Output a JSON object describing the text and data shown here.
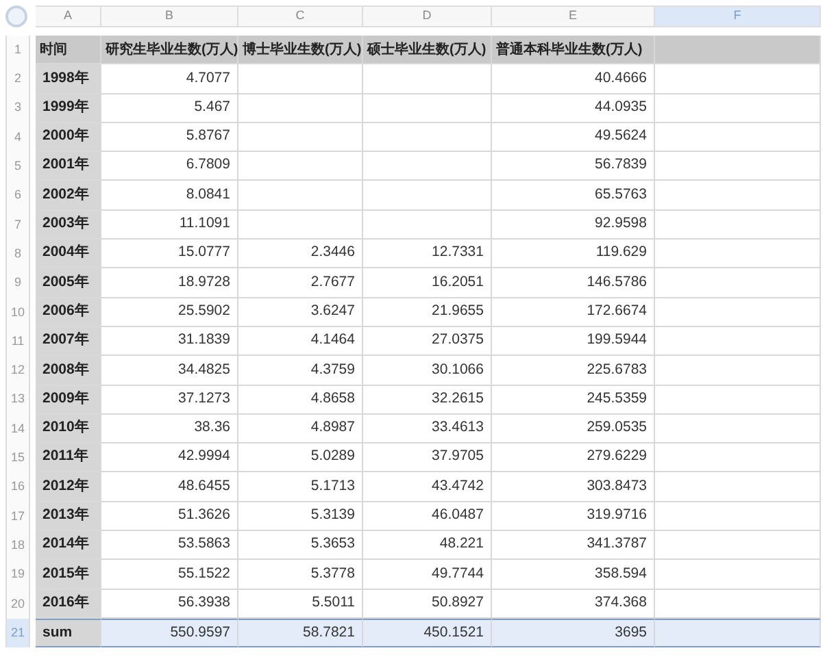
{
  "columns": [
    {
      "letter": "A",
      "selected": false
    },
    {
      "letter": "B",
      "selected": false
    },
    {
      "letter": "C",
      "selected": false
    },
    {
      "letter": "D",
      "selected": false
    },
    {
      "letter": "E",
      "selected": false
    },
    {
      "letter": "F",
      "selected": true
    }
  ],
  "rows": [
    {
      "number": "1",
      "kind": "header",
      "selected": false,
      "cells": [
        "时间",
        "研究生毕业生数(万人)",
        "博士毕业生数(万人)",
        "硕士毕业生数(万人)",
        "普通本科毕业生数(万人)"
      ]
    },
    {
      "number": "2",
      "kind": "data",
      "selected": false,
      "cells": [
        "1998年",
        "4.7077",
        null,
        null,
        "40.4666"
      ]
    },
    {
      "number": "3",
      "kind": "data",
      "selected": false,
      "cells": [
        "1999年",
        "5.467",
        null,
        null,
        "44.0935"
      ]
    },
    {
      "number": "4",
      "kind": "data",
      "selected": false,
      "cells": [
        "2000年",
        "5.8767",
        null,
        null,
        "49.5624"
      ]
    },
    {
      "number": "5",
      "kind": "data",
      "selected": false,
      "cells": [
        "2001年",
        "6.7809",
        null,
        null,
        "56.7839"
      ]
    },
    {
      "number": "6",
      "kind": "data",
      "selected": false,
      "cells": [
        "2002年",
        "8.0841",
        null,
        null,
        "65.5763"
      ]
    },
    {
      "number": "7",
      "kind": "data",
      "selected": false,
      "cells": [
        "2003年",
        "11.1091",
        null,
        null,
        "92.9598"
      ]
    },
    {
      "number": "8",
      "kind": "data",
      "selected": false,
      "cells": [
        "2004年",
        "15.0777",
        "2.3446",
        "12.7331",
        "119.629"
      ]
    },
    {
      "number": "9",
      "kind": "data",
      "selected": false,
      "cells": [
        "2005年",
        "18.9728",
        "2.7677",
        "16.2051",
        "146.5786"
      ]
    },
    {
      "number": "10",
      "kind": "data",
      "selected": false,
      "cells": [
        "2006年",
        "25.5902",
        "3.6247",
        "21.9655",
        "172.6674"
      ]
    },
    {
      "number": "11",
      "kind": "data",
      "selected": false,
      "cells": [
        "2007年",
        "31.1839",
        "4.1464",
        "27.0375",
        "199.5944"
      ]
    },
    {
      "number": "12",
      "kind": "data",
      "selected": false,
      "cells": [
        "2008年",
        "34.4825",
        "4.3759",
        "30.1066",
        "225.6783"
      ]
    },
    {
      "number": "13",
      "kind": "data",
      "selected": false,
      "cells": [
        "2009年",
        "37.1273",
        "4.8658",
        "32.2615",
        "245.5359"
      ]
    },
    {
      "number": "14",
      "kind": "data",
      "selected": false,
      "cells": [
        "2010年",
        "38.36",
        "4.8987",
        "33.4613",
        "259.0535"
      ]
    },
    {
      "number": "15",
      "kind": "data",
      "selected": false,
      "cells": [
        "2011年",
        "42.9994",
        "5.0289",
        "37.9705",
        "279.6229"
      ]
    },
    {
      "number": "16",
      "kind": "data",
      "selected": false,
      "cells": [
        "2012年",
        "48.6455",
        "5.1713",
        "43.4742",
        "303.8473"
      ]
    },
    {
      "number": "17",
      "kind": "data",
      "selected": false,
      "cells": [
        "2013年",
        "51.3626",
        "5.3139",
        "46.0487",
        "319.9716"
      ]
    },
    {
      "number": "18",
      "kind": "data",
      "selected": false,
      "cells": [
        "2014年",
        "53.5863",
        "5.3653",
        "48.221",
        "341.3787"
      ]
    },
    {
      "number": "19",
      "kind": "data",
      "selected": false,
      "cells": [
        "2015年",
        "55.1522",
        "5.3778",
        "49.7744",
        "358.594"
      ]
    },
    {
      "number": "20",
      "kind": "data",
      "selected": false,
      "cells": [
        "2016年",
        "56.3938",
        "5.5011",
        "50.8927",
        "374.368"
      ]
    },
    {
      "number": "21",
      "kind": "data",
      "selected": true,
      "cells": [
        "sum",
        "550.9597",
        "58.7821",
        "450.1521",
        "3695"
      ]
    }
  ]
}
